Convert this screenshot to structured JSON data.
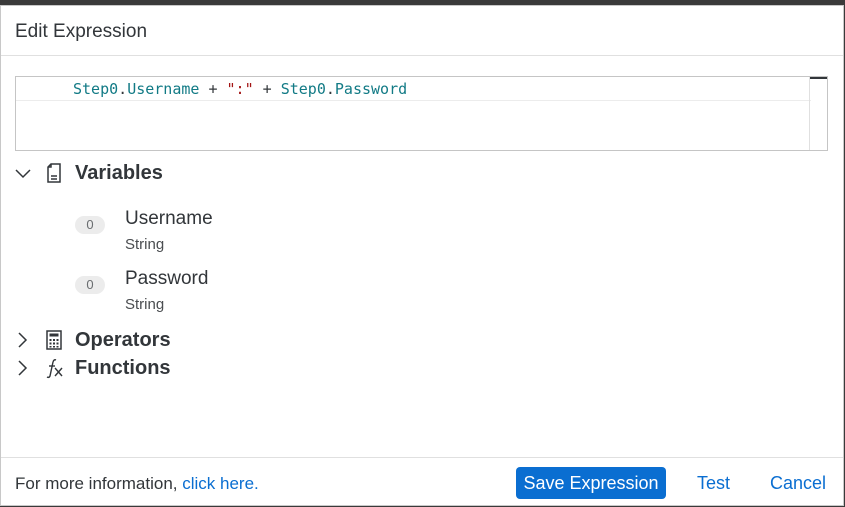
{
  "dialog": {
    "title": "Edit Expression"
  },
  "editor": {
    "tokens": [
      {
        "text": "Step0",
        "kind": "ident"
      },
      {
        "text": ".",
        "kind": "op"
      },
      {
        "text": "Username",
        "kind": "ident"
      },
      {
        "text": " + ",
        "kind": "op"
      },
      {
        "text": "\":\"",
        "kind": "str"
      },
      {
        "text": " + ",
        "kind": "op"
      },
      {
        "text": "Step0",
        "kind": "ident"
      },
      {
        "text": ".",
        "kind": "op"
      },
      {
        "text": "Password",
        "kind": "ident"
      }
    ]
  },
  "sections": {
    "variables": {
      "label": "Variables",
      "icon": "document-icon",
      "expanded": true,
      "items": [
        {
          "badge": "0",
          "name": "Username",
          "type": "String"
        },
        {
          "badge": "0",
          "name": "Password",
          "type": "String"
        }
      ]
    },
    "operators": {
      "label": "Operators",
      "icon": "calculator-icon",
      "expanded": false
    },
    "functions": {
      "label": "Functions",
      "icon": "fx-icon",
      "expanded": false
    }
  },
  "footer": {
    "info_text": "For more information, ",
    "info_link": "click here.",
    "save_label": "Save Expression",
    "test_label": "Test",
    "cancel_label": "Cancel"
  },
  "colors": {
    "accent": "#0a6ed1",
    "identifier": "#117a85",
    "string": "#a31515"
  }
}
